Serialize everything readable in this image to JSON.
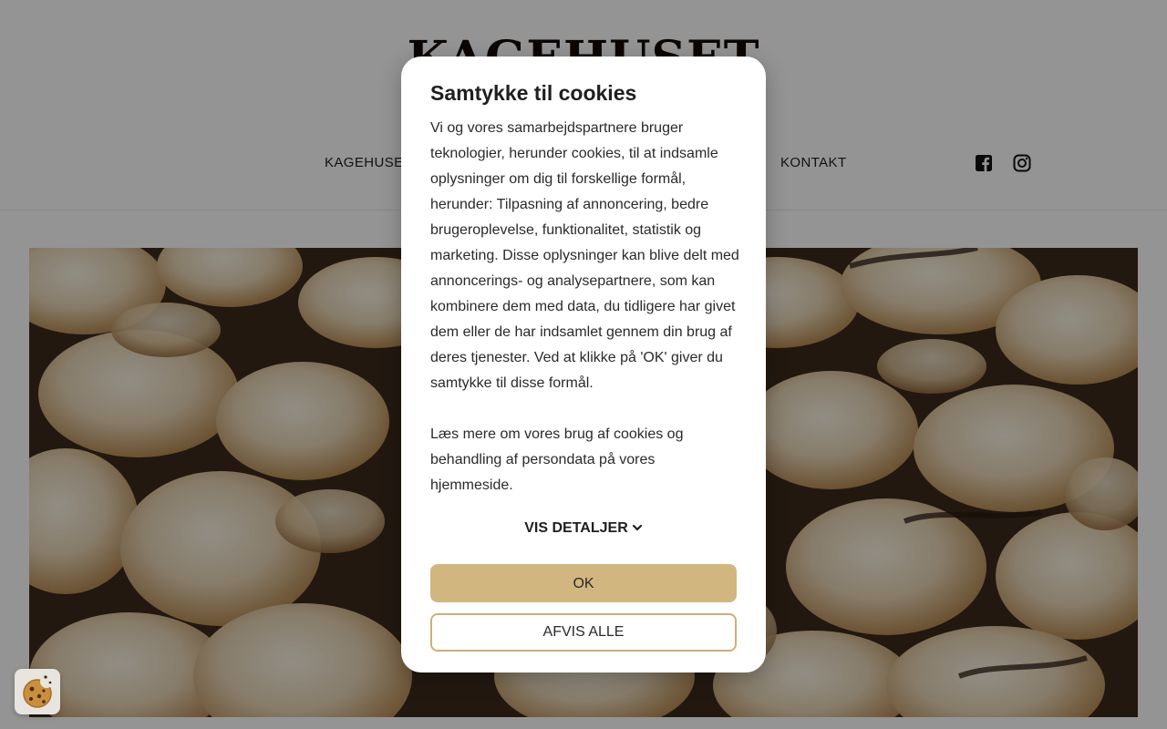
{
  "site": {
    "logo": "KAGEHUSET",
    "nav": [
      {
        "label": "KAGEHUSENE"
      },
      {
        "label": "KONTAKT"
      }
    ],
    "social": [
      "facebook-icon",
      "instagram-icon"
    ]
  },
  "cookie_dialog": {
    "title": "Samtykke til cookies",
    "paragraph_1": "Vi og vores samarbejdspartnere bruger teknologier, herunder cookies, til at indsamle oplysninger om dig til forskellige formål, herunder: Tilpasning af annoncering, bedre brugeroplevelse, funktionalitet, statistik og marketing. Disse oplysninger kan blive delt med annoncerings- og analysepartnere, som kan kombinere dem med data, du tidligere har givet dem eller de har indsamlet gennem din brug af deres tjenester. Ved at klikke på 'OK' giver du samtykke til disse formål.",
    "paragraph_2": "Læs mere om vores brug af cookies og behandling af persondata på vores hjemmeside.",
    "details_label": "VIS DETALJER",
    "ok_label": "OK",
    "reject_label": "AFVIS ALLE"
  },
  "colors": {
    "accent": "#d1b680",
    "accent_border": "#cbb07a"
  },
  "floating_button": {
    "icon": "cookie-icon"
  }
}
